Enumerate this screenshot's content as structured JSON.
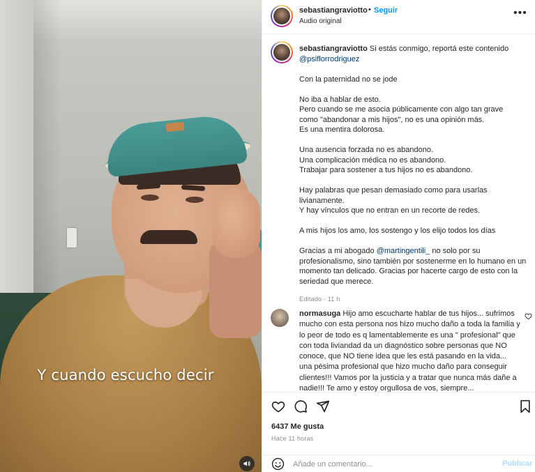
{
  "video": {
    "caption": "Y cuando escucho decir",
    "mute_icon": "speaker-icon"
  },
  "header": {
    "username": "sebastiangraviotto",
    "separator": "•",
    "follow_label": "Seguir",
    "audio_label": "Audio original",
    "more_icon": "more-horizontal-icon",
    "more_glyph": "•••"
  },
  "post_caption": {
    "username": "sebastiangraviotto",
    "intro": "Si estás conmigo, reportá este contenido",
    "mention": "@psiflorrodriguez",
    "p1": "Con la paternidad no se jode",
    "p2_l1": "No iba a hablar de esto.",
    "p2_l2": "Pero cuando se me asocia públicamente con algo tan grave",
    "p2_l3": "como \"abandonar a mis hijos\", no es una opinión más.",
    "p2_l4": "Es una mentira dolorosa.",
    "p3_l1": "Una ausencia forzada no es abandono.",
    "p3_l2": "Una complicación médica no es abandono.",
    "p3_l3": "Trabajar para sostener a tus hijos no es abandono.",
    "p4_l1": "Hay palabras que pesan demasiado como para usarlas",
    "p4_l2": "livianamente.",
    "p4_l3": "Y hay vínculos que no entran en un recorte de redes.",
    "p5": "A mis hijos los amo, los sostengo y los elijo todos los días",
    "p6_a": "Gracias a mi abogado",
    "p6_mention": "@martingentili_",
    "p6_b": "no solo por su profesionalismo, sino también por sostenerme en lo humano en un momento tan delicado. Gracias por hacerte cargo de esto con la seriedad que merece.",
    "edited": "Editado",
    "edited_sep": "·",
    "edited_time": "11 h"
  },
  "comment": {
    "username": "normasuga",
    "text": "Hijo amo escucharte hablar de tus hijos... sufrimos mucho con esta persona nos hizo mucho daño a toda la familia y lo peor de todo es q lamentablemente es una \" profesional\" que con toda liviandad da un diagnóstico sobre personas que NO conoce, que NO tiene idea que les está pasando en la vida... una pésima profesional que hizo mucho daño para conseguir clientes!!! Vamos por la justicia y a tratar que nunca más dañe a nadie!!! Te amo y estoy orgullosa de vos, siempre...",
    "like_icon": "heart-outline-icon"
  },
  "actions": {
    "like_icon": "heart-icon",
    "comment_icon": "comment-icon",
    "share_icon": "send-icon",
    "save_icon": "bookmark-icon",
    "likes": "6437 Me gusta",
    "time": "Hace 11 horas"
  },
  "add_comment": {
    "emoji_icon": "emoji-icon",
    "placeholder": "Añade un comentario...",
    "post_label": "Publicar"
  },
  "colors": {
    "link_blue": "#0095f6",
    "mention": "#00376b",
    "secondary_text": "#8e8e8e",
    "publish_disabled": "#b3dbff"
  }
}
